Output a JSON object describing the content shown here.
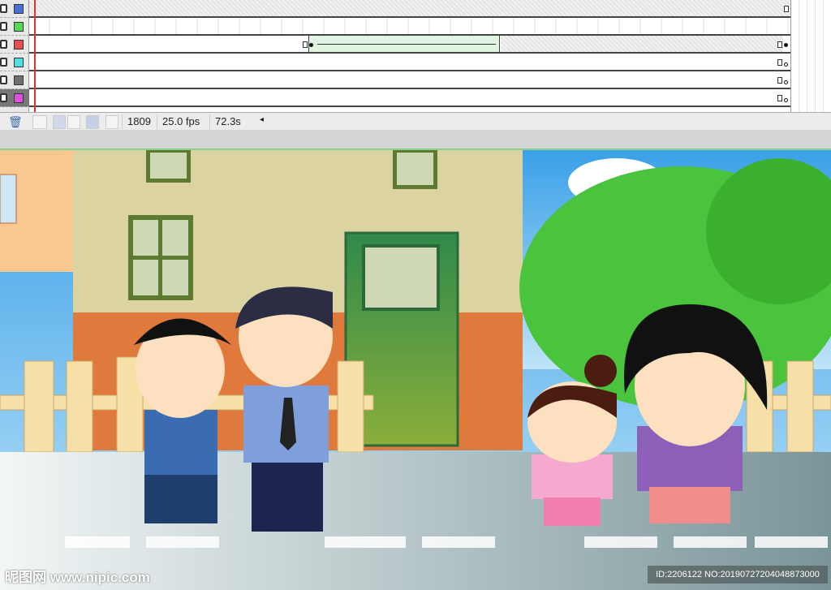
{
  "timeline": {
    "layers": [
      {
        "color": "#4a6fd8"
      },
      {
        "color": "#55d855"
      },
      {
        "color": "#e85050"
      },
      {
        "color": "#50e0e0"
      },
      {
        "color": "#707070"
      },
      {
        "color": "#e050e0",
        "selected": true
      }
    ],
    "frame_number": "1809",
    "fps": "25.0 fps",
    "elapsed": "72.3s"
  },
  "watermark": {
    "site": "昵图网 www.nipic.com",
    "id": "ID:2206122 NO:20190727204048873000"
  }
}
